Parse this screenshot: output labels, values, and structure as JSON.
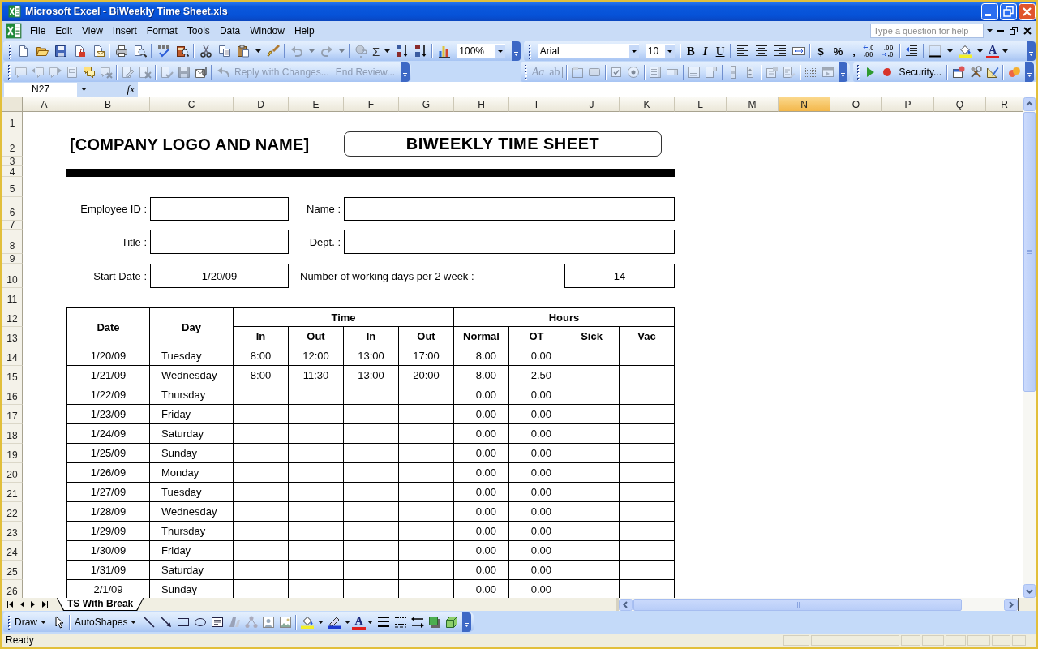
{
  "window": {
    "title": "Microsoft Excel - BiWeekly Time Sheet.xls"
  },
  "menu_bar": {
    "items": [
      "File",
      "Edit",
      "View",
      "Insert",
      "Format",
      "Tools",
      "Data",
      "Window",
      "Help"
    ],
    "help_box": {
      "placeholder": "Type a question for help"
    }
  },
  "standard_toolbar": {
    "autosum": "Σ",
    "zoom": "100%"
  },
  "formatting_toolbar": {
    "font": "Arial",
    "font_size": "10",
    "style_buttons": [
      {
        "label": "B",
        "kind": "bold"
      },
      {
        "label": "I",
        "kind": "italic"
      },
      {
        "label": "U",
        "kind": "underline"
      }
    ],
    "number_buttons": [
      "$",
      "%",
      ","
    ],
    "font_color": "A"
  },
  "reviewing_toolbar": {
    "buttons": [
      {
        "label": "Reply with Changes...",
        "disabled": true
      },
      {
        "label": "End Review...",
        "disabled": true
      }
    ]
  },
  "forms_toolbar": {
    "tools": [
      {
        "label": "Aa",
        "kind": "label",
        "disabled": true
      },
      {
        "label": "ab",
        "kind": "edit_box",
        "disabled": true
      }
    ]
  },
  "visual_basic_toolbar": {
    "security": "Security..."
  },
  "formula_bar": {
    "name_box": "N27",
    "function_label": "fx"
  },
  "sheet": {
    "columns": [
      {
        "label": "A",
        "selected": false
      },
      {
        "label": "B",
        "selected": false
      },
      {
        "label": "C",
        "selected": false
      },
      {
        "label": "D",
        "selected": false
      },
      {
        "label": "E",
        "selected": false
      },
      {
        "label": "F",
        "selected": false
      },
      {
        "label": "G",
        "selected": false
      },
      {
        "label": "H",
        "selected": false
      },
      {
        "label": "I",
        "selected": false
      },
      {
        "label": "J",
        "selected": false
      },
      {
        "label": "K",
        "selected": false
      },
      {
        "label": "L",
        "selected": false
      },
      {
        "label": "M",
        "selected": false
      },
      {
        "label": "N",
        "selected": true
      },
      {
        "label": "O",
        "selected": false
      },
      {
        "label": "P",
        "selected": false
      },
      {
        "label": "Q",
        "selected": false
      },
      {
        "label": "R",
        "selected": false
      }
    ],
    "row_headers": [
      "1",
      "2",
      "3",
      "4",
      "5",
      "6",
      "7",
      "8",
      "9",
      "10",
      "11",
      "12",
      "13",
      "14",
      "15",
      "16",
      "17",
      "18",
      "19",
      "20",
      "21",
      "22",
      "23",
      "24",
      "25",
      "26"
    ],
    "company_name": "[COMPANY LOGO AND NAME]",
    "title": "BIWEEKLY TIME SHEET",
    "fields": [
      {
        "label": "Employee ID :"
      },
      {
        "label": "Name :"
      },
      {
        "label": "Title :"
      },
      {
        "label": "Dept. :"
      },
      {
        "label": "Start Date :",
        "value": "1/20/09"
      },
      {
        "label": "Number of working days per 2 week :",
        "value": "14"
      }
    ],
    "timesheet": {
      "date_header": "Date",
      "day_header": "Day",
      "groups": [
        {
          "label": "Time",
          "columns": [
            "In",
            "Out",
            "In",
            "Out"
          ]
        },
        {
          "label": "Hours",
          "columns": [
            "Normal",
            "OT",
            "Sick",
            "Vac"
          ]
        }
      ],
      "rows": [
        {
          "date": "1/20/09",
          "day": "Tuesday",
          "times": [
            "8:00",
            "12:00",
            "13:00",
            "17:00"
          ],
          "hours": [
            "8.00",
            "0.00"
          ]
        },
        {
          "date": "1/21/09",
          "day": "Wednesday",
          "times": [
            "8:00",
            "11:30",
            "13:00",
            "20:00"
          ],
          "hours": [
            "8.00",
            "2.50"
          ]
        },
        {
          "date": "1/22/09",
          "day": "Thursday",
          "hours": [
            "0.00",
            "0.00"
          ]
        },
        {
          "date": "1/23/09",
          "day": "Friday",
          "hours": [
            "0.00",
            "0.00"
          ]
        },
        {
          "date": "1/24/09",
          "day": "Saturday",
          "hours": [
            "0.00",
            "0.00"
          ]
        },
        {
          "date": "1/25/09",
          "day": "Sunday",
          "hours": [
            "0.00",
            "0.00"
          ]
        },
        {
          "date": "1/26/09",
          "day": "Monday",
          "hours": [
            "0.00",
            "0.00"
          ]
        },
        {
          "date": "1/27/09",
          "day": "Tuesday",
          "hours": [
            "0.00",
            "0.00"
          ]
        },
        {
          "date": "1/28/09",
          "day": "Wednesday",
          "hours": [
            "0.00",
            "0.00"
          ]
        },
        {
          "date": "1/29/09",
          "day": "Thursday",
          "hours": [
            "0.00",
            "0.00"
          ]
        },
        {
          "date": "1/30/09",
          "day": "Friday",
          "hours": [
            "0.00",
            "0.00"
          ]
        },
        {
          "date": "1/31/09",
          "day": "Saturday",
          "hours": [
            "0.00",
            "0.00"
          ]
        },
        {
          "date": "2/1/09",
          "day": "Sunday",
          "hours": [
            "0.00",
            "0.00"
          ]
        }
      ]
    }
  },
  "sheet_tabs": [
    {
      "label": "TS With Break",
      "selected": true
    }
  ],
  "drawing_toolbar": {
    "draw": "Draw",
    "autoshapes": "AutoShapes",
    "font_color": "A"
  },
  "status_bar": {
    "text": "Ready"
  }
}
